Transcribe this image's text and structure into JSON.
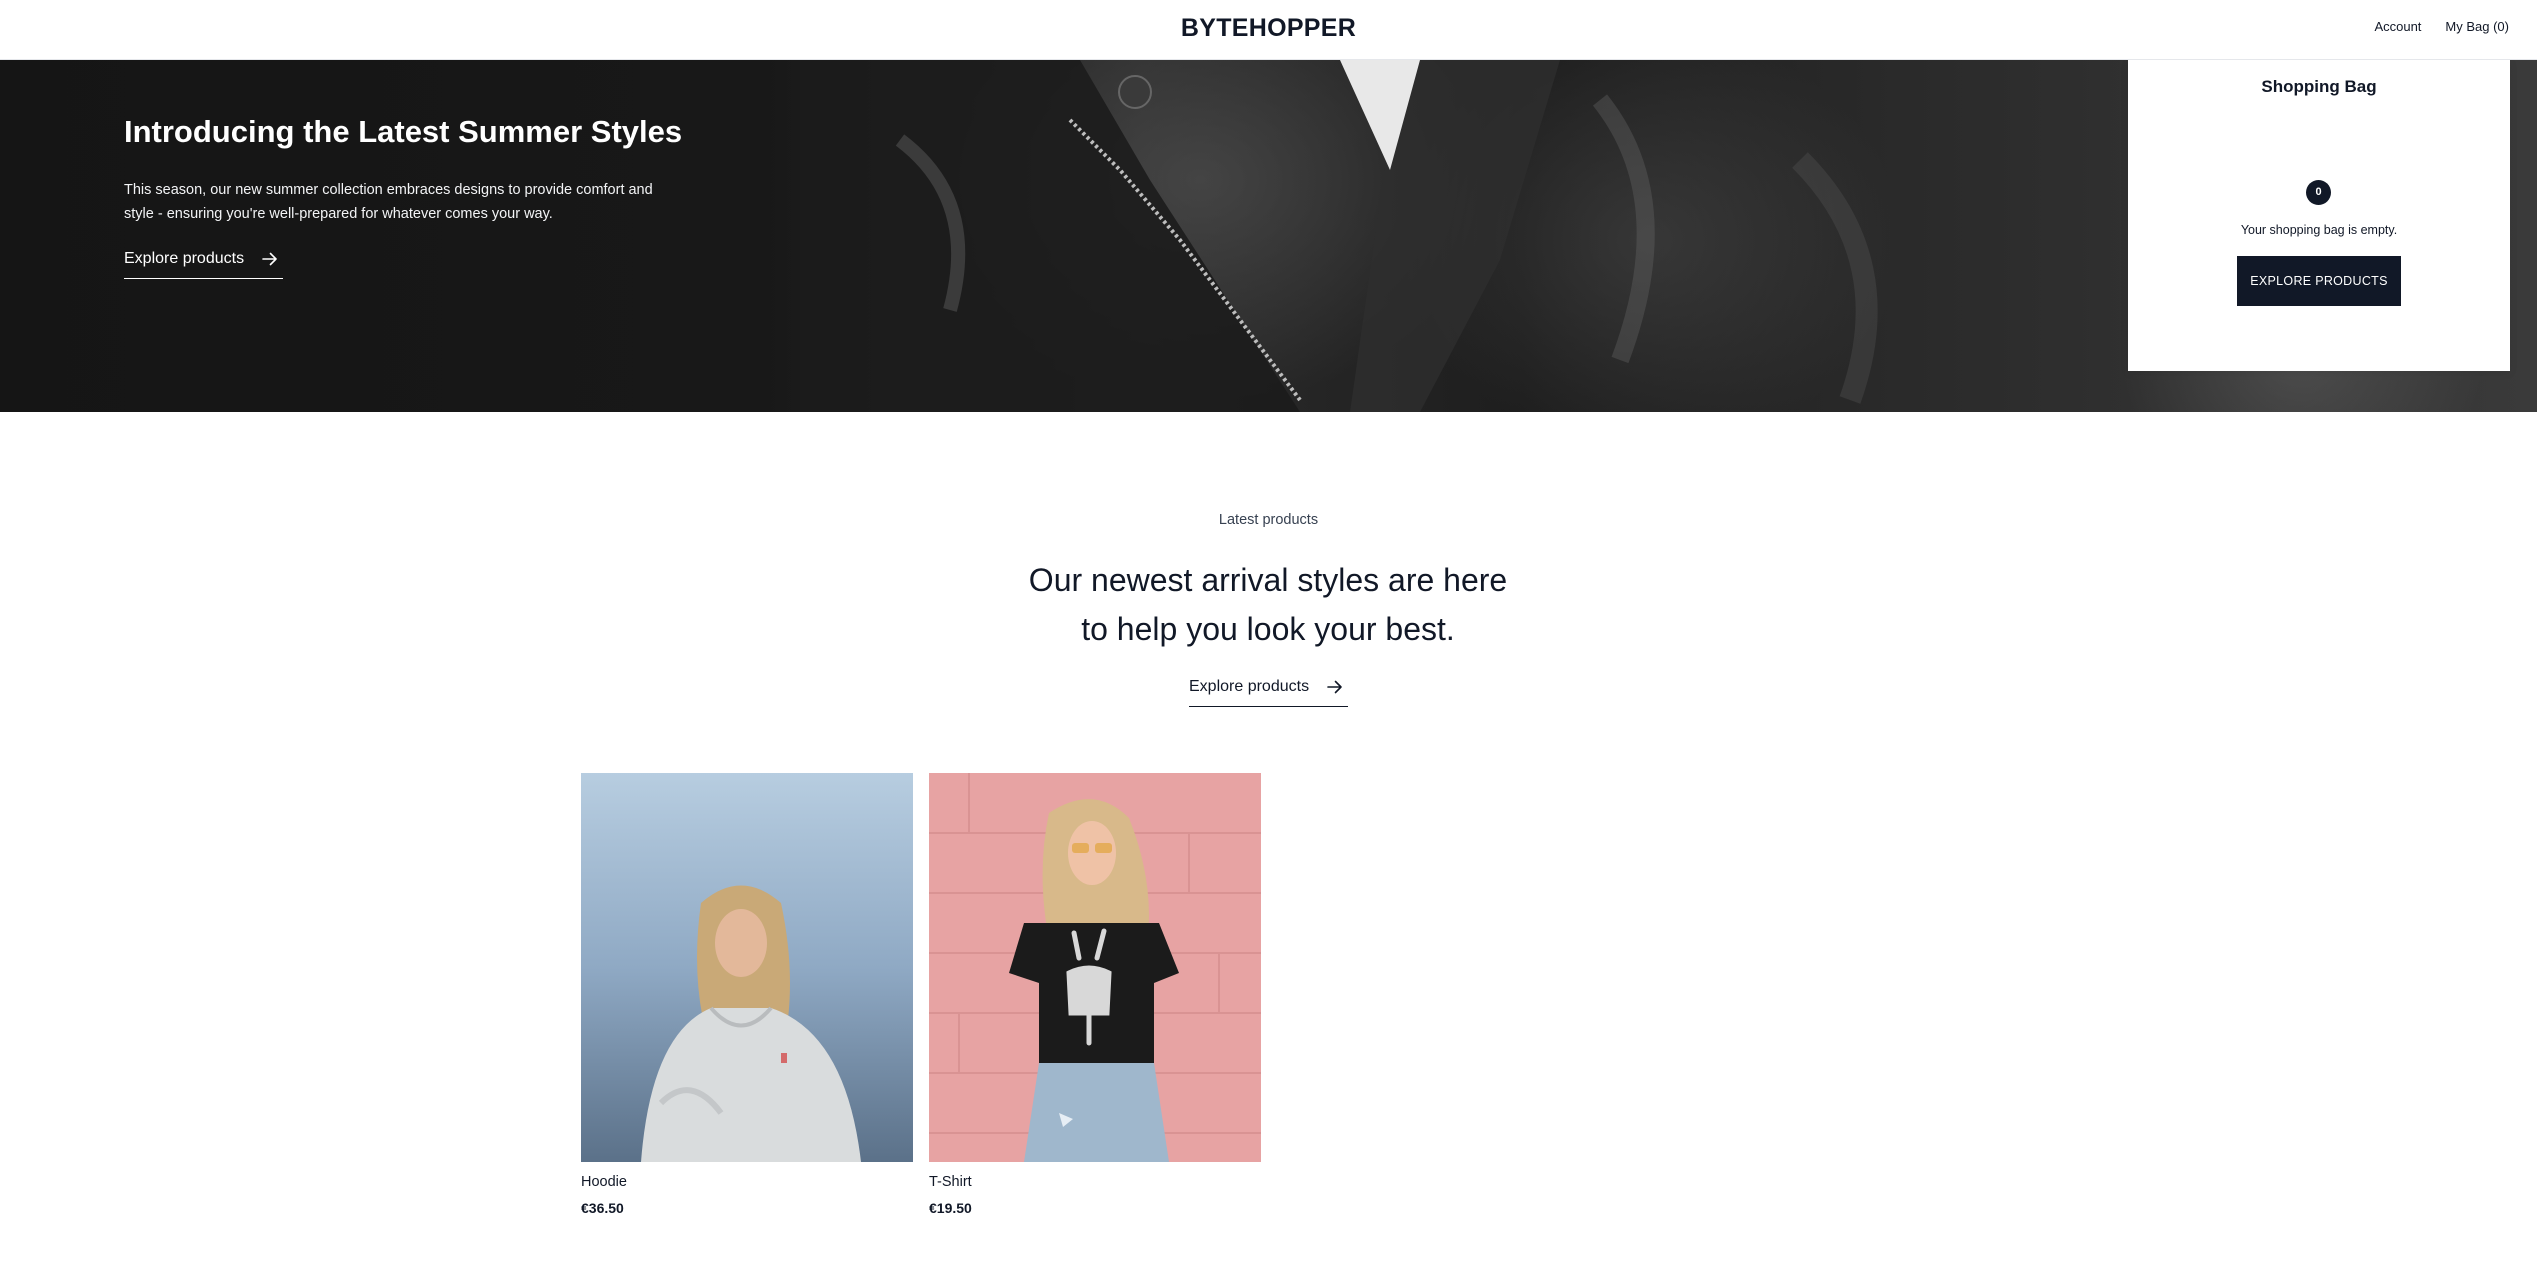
{
  "header": {
    "logo": "BYTEHOPPER",
    "account_label": "Account",
    "bag_label": "My Bag (0)"
  },
  "hero": {
    "title": "Introducing the Latest Summer Styles",
    "description": "This season, our new summer collection embraces designs to provide comfort and style - ensuring you're well-prepared for whatever comes your way.",
    "link_label": "Explore products",
    "link_icon": "arrow-right-icon"
  },
  "bag_panel": {
    "title": "Shopping Bag",
    "count": "0",
    "empty_message": "Your shopping bag is empty.",
    "button_label": "EXPLORE PRODUCTS"
  },
  "latest": {
    "eyebrow": "Latest products",
    "title": "Our newest arrival styles are here to help you look your best.",
    "link_label": "Explore products",
    "link_icon": "arrow-right-icon"
  },
  "products": [
    {
      "name": "Hoodie",
      "price": "€36.50"
    },
    {
      "name": "T-Shirt",
      "price": "€19.50"
    }
  ],
  "colors": {
    "primary_dark": "#111827",
    "hero_bg": "#141414",
    "hoodie_bg": "#9bb4c9",
    "tshirt_bg": "#e7a3a3"
  }
}
